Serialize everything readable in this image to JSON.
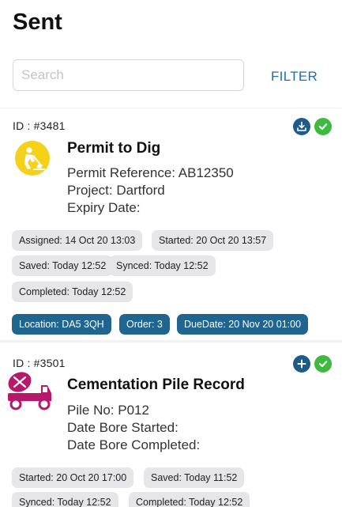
{
  "header": {
    "title": "Sent",
    "search_placeholder": "Search",
    "filter_label": "FILTER"
  },
  "permits": [
    {
      "id": "ID : #3481",
      "title": "Permit to Dig",
      "details": [
        "Permit Reference: AB12350",
        "Project: Dartford",
        "Expiry Date:"
      ],
      "icon": "digging-worker-icon",
      "status_icons": [
        "download-icon",
        "check-icon"
      ],
      "tags": [
        "Assigned: 14 Oct 20 13:03",
        "Started: 20 Oct 20 13:57",
        "Saved: Today 12:52",
        "Synced: Today 12:52",
        "Completed: Today 12:52"
      ],
      "info_tags": [
        "Location: DA5 3QH",
        "Order: 3",
        "DueDate: 20 Nov 20 01:00"
      ]
    },
    {
      "id": "ID : #3501",
      "title": "Cementation Pile Record",
      "details": [
        "Pile No: P012",
        "Date Bore Started:",
        "Date Bore Completed:"
      ],
      "icon": "cement-mixer-truck-icon",
      "status_icons": [
        "add-icon",
        "check-icon"
      ],
      "tags": [
        "Started: 20 Oct 20 17:00",
        "Saved: Today 11:52",
        "Synced: Today 12:52",
        "Completed: Today 12:52"
      ]
    }
  ],
  "colors": {
    "accent": "#1f6fa5",
    "status_blue": "#1d5c8a",
    "status_green": "#3dba3f",
    "dig_icon_yellow": "#f5d11a",
    "mixer_icon_magenta": "#b7186a"
  }
}
